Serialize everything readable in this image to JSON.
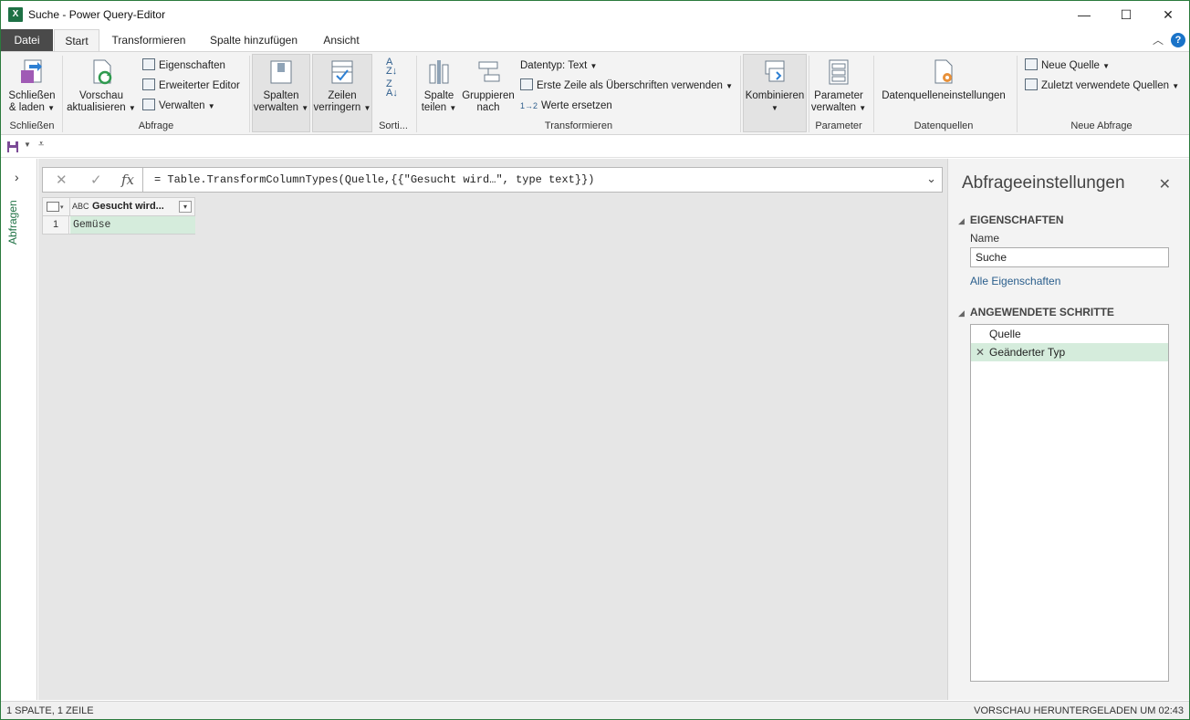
{
  "window": {
    "title": "Suche - Power Query-Editor",
    "app_icon": "X"
  },
  "window_controls": {
    "minimize": "—",
    "maximize": "☐",
    "close": "✕"
  },
  "tabs": [
    {
      "label": "Datei"
    },
    {
      "label": "Start"
    },
    {
      "label": "Transformieren"
    },
    {
      "label": "Spalte hinzufügen"
    },
    {
      "label": "Ansicht"
    }
  ],
  "help_label": "?",
  "ribbon": {
    "schliessen": {
      "btn_line1": "Schließen",
      "btn_line2": "& laden",
      "group": "Schließen"
    },
    "abfrage": {
      "vorschau_line1": "Vorschau",
      "vorschau_line2": "aktualisieren",
      "eigenschaften": "Eigenschaften",
      "erweiterter_editor": "Erweiterter Editor",
      "verwalten": "Verwalten",
      "group": "Abfrage"
    },
    "spalten": {
      "line1": "Spalten",
      "line2": "verwalten"
    },
    "zeilen": {
      "line1": "Zeilen",
      "line2": "verringern"
    },
    "sortieren": {
      "group": "Sorti..."
    },
    "transformieren": {
      "spalte_line1": "Spalte",
      "spalte_line2": "teilen",
      "gruppieren_line1": "Gruppieren",
      "gruppieren_line2": "nach",
      "datentyp": "Datentyp: Text",
      "erste_zeile": "Erste Zeile als Überschriften verwenden",
      "werte_ersetzen": "Werte ersetzen",
      "group": "Transformieren"
    },
    "kombinieren": {
      "label": "Kombinieren"
    },
    "parameter": {
      "line1": "Parameter",
      "line2": "verwalten",
      "group": "Parameter"
    },
    "datenquellen": {
      "label": "Datenquelleneinstellungen",
      "group": "Datenquellen"
    },
    "neue_abfrage": {
      "neue_quelle": "Neue Quelle",
      "zuletzt": "Zuletzt verwendete Quellen",
      "group": "Neue Abfrage"
    }
  },
  "query_pane": {
    "label": "Abfragen"
  },
  "formula_bar": {
    "cancel": "✕",
    "confirm": "✓",
    "fx": "fx",
    "text": "= Table.TransformColumnTypes(Quelle,{{\"Gesucht wird…\", type text}})"
  },
  "grid": {
    "column_type": "ABC",
    "column_header": "Gesucht wird...",
    "rows": [
      {
        "index": "1",
        "value": "Gemüse"
      }
    ]
  },
  "settings": {
    "title": "Abfrageeinstellungen",
    "properties_heading": "EIGENSCHAFTEN",
    "name_label": "Name",
    "name_value": "Suche",
    "all_properties": "Alle Eigenschaften",
    "steps_heading": "ANGEWENDETE SCHRITTE",
    "steps": [
      {
        "label": "Quelle"
      },
      {
        "label": "Geänderter Typ"
      }
    ]
  },
  "status": {
    "left": "1 SPALTE, 1 ZEILE",
    "right": "VORSCHAU HERUNTERGELADEN UM 02:43"
  },
  "colors": {
    "accent": "#217346",
    "active_step": "#d5ecdc",
    "file_tab": "#4a4a4a"
  }
}
